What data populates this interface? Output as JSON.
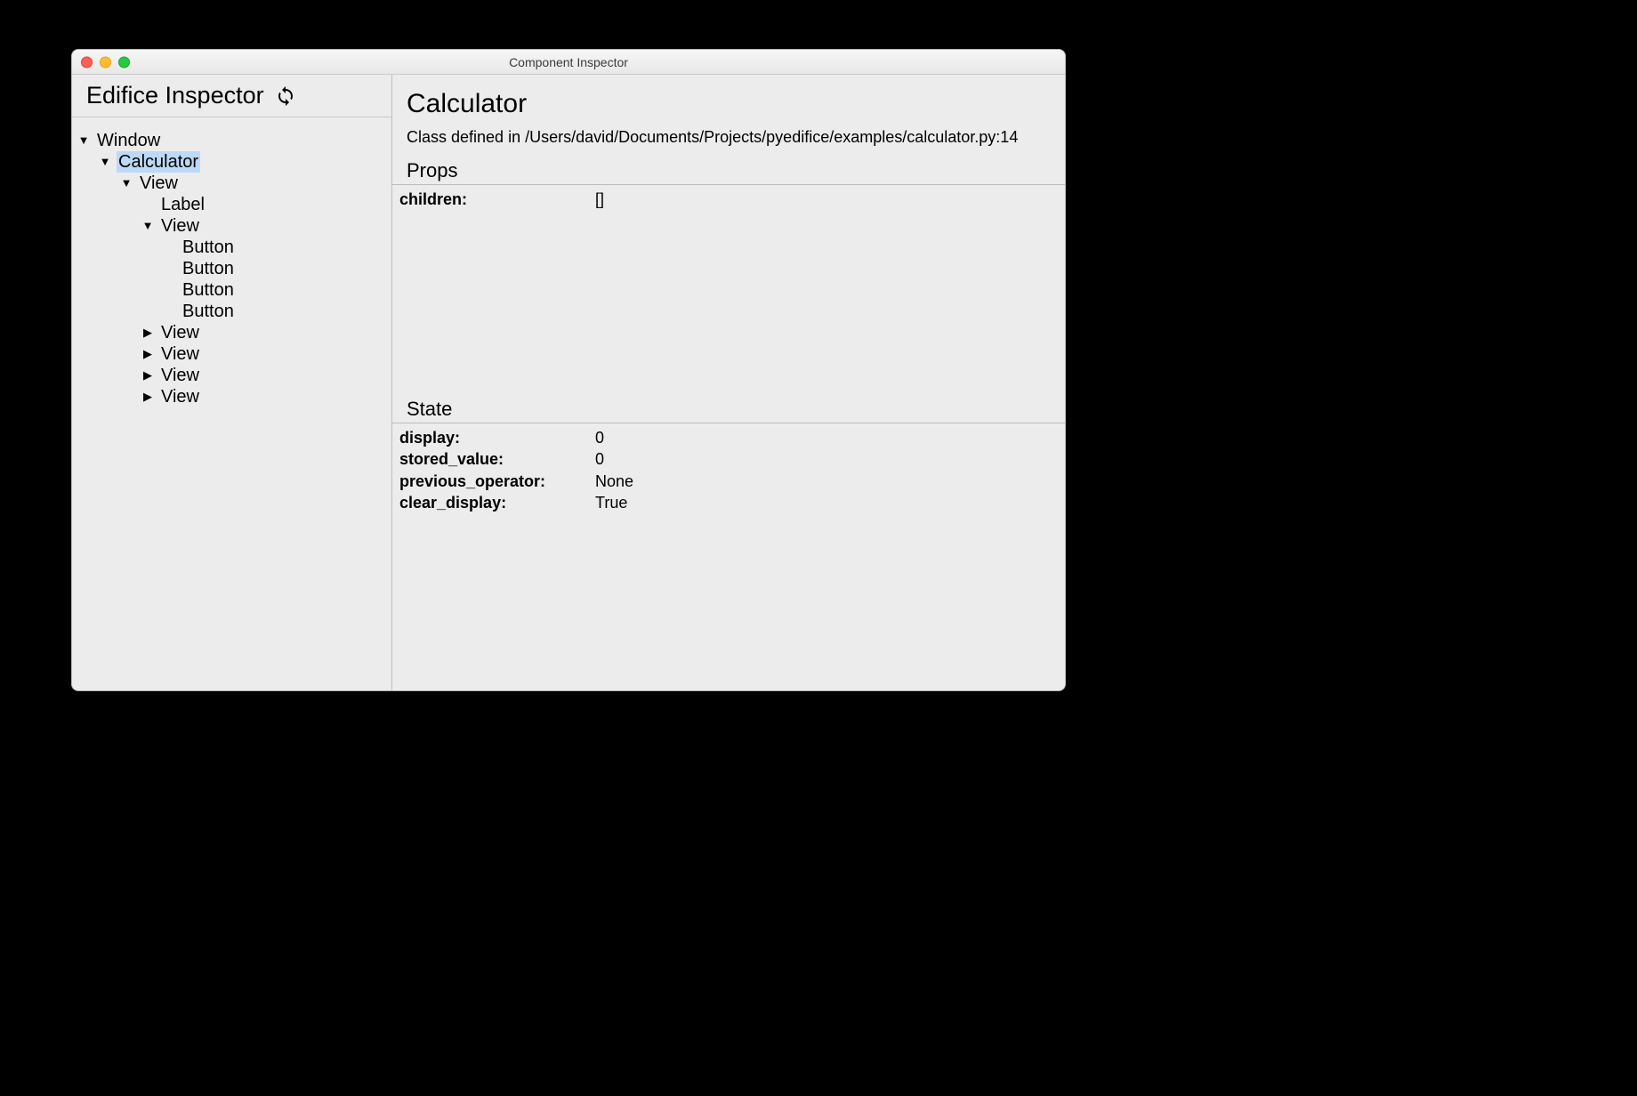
{
  "window": {
    "title": "Component Inspector"
  },
  "sidebar": {
    "title": "Edifice Inspector",
    "tree": {
      "n0": {
        "label": "Window",
        "arrow": "down"
      },
      "n1": {
        "label": "Calculator",
        "arrow": "down",
        "selected": true
      },
      "n2": {
        "label": "View",
        "arrow": "down"
      },
      "n3": {
        "label": "Label",
        "arrow": "none"
      },
      "n4": {
        "label": "View",
        "arrow": "down"
      },
      "n5": {
        "label": "Button",
        "arrow": "none"
      },
      "n6": {
        "label": "Button",
        "arrow": "none"
      },
      "n7": {
        "label": "Button",
        "arrow": "none"
      },
      "n8": {
        "label": "Button",
        "arrow": "none"
      },
      "n9": {
        "label": "View",
        "arrow": "right"
      },
      "n10": {
        "label": "View",
        "arrow": "right"
      },
      "n11": {
        "label": "View",
        "arrow": "right"
      },
      "n12": {
        "label": "View",
        "arrow": "right"
      }
    }
  },
  "details": {
    "component_title": "Calculator",
    "class_line": "Class defined in /Users/david/Documents/Projects/pyedifice/examples/calculator.py:14",
    "props_header": "Props",
    "props": {
      "children": {
        "key": "children:",
        "value": "[]"
      }
    },
    "state_header": "State",
    "state": {
      "display": {
        "key": "display:",
        "value": "0"
      },
      "stored_value": {
        "key": "stored_value:",
        "value": "0"
      },
      "previous_operator": {
        "key": "previous_operator:",
        "value": "None"
      },
      "clear_display": {
        "key": "clear_display:",
        "value": "True"
      }
    }
  }
}
